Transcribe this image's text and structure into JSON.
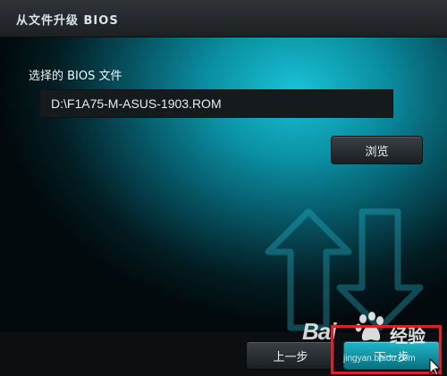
{
  "window": {
    "title": "从文件升级 BIOS"
  },
  "form": {
    "file_label": "选择的 BIOS 文件",
    "file_path": "D:\\F1A75-M-ASUS-1903.ROM",
    "browse_label": "浏览"
  },
  "footer": {
    "prev_label": "上一步",
    "next_label": "下一步"
  },
  "watermark": {
    "brand": "Bai",
    "brand_cn": "经验",
    "url": "jingyan.baidu.com"
  },
  "icons": {
    "arrows": "upload-download-arrows-icon",
    "cursor": "mouse-cursor-icon"
  },
  "colors": {
    "accent": "#19c2d6",
    "highlight": "#e01f26",
    "next_button": "#1fb7c9"
  }
}
